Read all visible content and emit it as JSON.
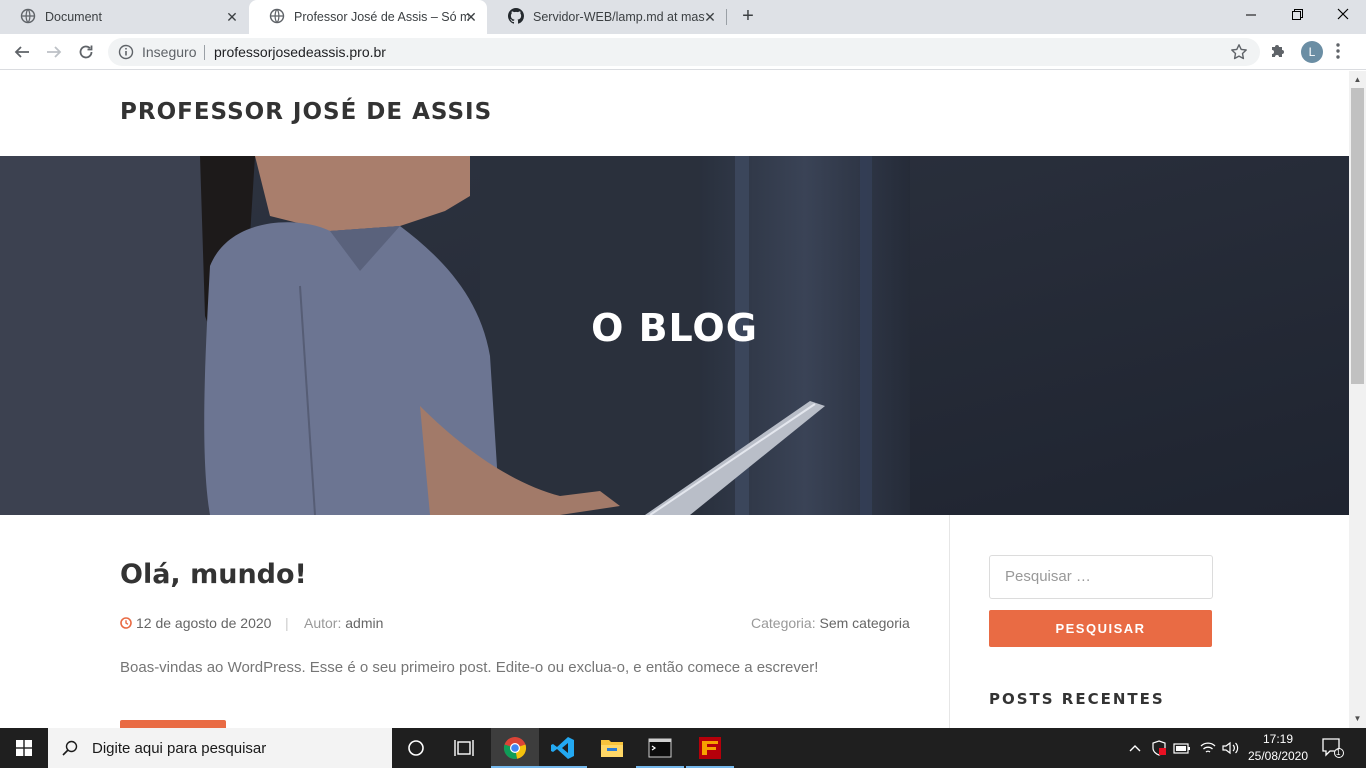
{
  "browser": {
    "tabs": [
      {
        "title": "Document",
        "icon": "globe-icon",
        "active": false
      },
      {
        "title": "Professor José de Assis – Só mais",
        "icon": "globe-icon",
        "active": true
      },
      {
        "title": "Servidor-WEB/lamp.md at maste",
        "icon": "github-icon",
        "active": false
      }
    ],
    "new_tab": "+",
    "address": {
      "security_label": "Inseguro",
      "url": "professorjosedeassis.pro.br"
    },
    "profile_initial": "L"
  },
  "page": {
    "site_title": "PROFESSOR JOSÉ DE ASSIS",
    "hero_title": "O BLOG",
    "post": {
      "title": "Olá, mundo!",
      "date": "12 de agosto de 2020",
      "separator": "|",
      "author_label": "Autor:",
      "author": "admin",
      "category_label": "Categoria:",
      "category": "Sem categoria",
      "excerpt": "Boas-vindas ao WordPress. Esse é o seu primeiro post. Edite-o ou exclua-o, e então comece a escrever!"
    },
    "sidebar": {
      "search_placeholder": "Pesquisar …",
      "search_button": "PESQUISAR",
      "recent_posts_title": "POSTS RECENTES"
    },
    "accent_color": "#e96b44"
  },
  "taskbar": {
    "search_placeholder": "Digite aqui para pesquisar",
    "time": "17:19",
    "date": "25/08/2020",
    "notification_count": "1"
  }
}
